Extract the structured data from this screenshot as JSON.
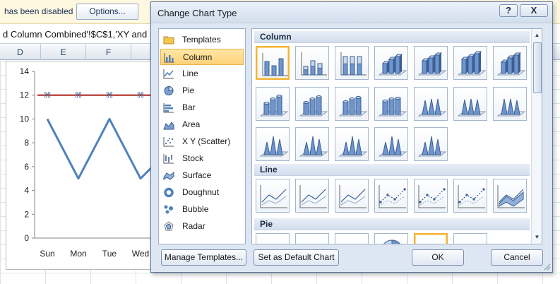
{
  "excel": {
    "message": "has been disabled",
    "options_label": "Options...",
    "formula": "d Column Combined'!$C$1,'XY and",
    "columns": [
      "D",
      "E",
      "F"
    ]
  },
  "chart_data": {
    "type": "line",
    "categories": [
      "Sun",
      "Mon",
      "Tue",
      "Wed"
    ],
    "series": [
      {
        "values": [
          10,
          5,
          10,
          5
        ],
        "color": "#4f81bd"
      },
      {
        "values": [
          12,
          12,
          12,
          12
        ],
        "color": "#c0504d"
      }
    ],
    "ylim": [
      0,
      14
    ],
    "yticks": [
      "14",
      "12",
      "10",
      "8",
      "6",
      "4",
      "2",
      "0"
    ],
    "grid": false
  },
  "dialog": {
    "title": "Change Chart Type",
    "help": "?",
    "close": "X",
    "chart_types": [
      {
        "label": "Templates",
        "icon": "folder-icon"
      },
      {
        "label": "Column",
        "icon": "column-chart-icon",
        "selected": true
      },
      {
        "label": "Line",
        "icon": "line-chart-icon"
      },
      {
        "label": "Pie",
        "icon": "pie-chart-icon"
      },
      {
        "label": "Bar",
        "icon": "bar-chart-icon"
      },
      {
        "label": "Area",
        "icon": "area-chart-icon"
      },
      {
        "label": "X Y (Scatter)",
        "icon": "scatter-chart-icon"
      },
      {
        "label": "Stock",
        "icon": "stock-chart-icon"
      },
      {
        "label": "Surface",
        "icon": "surface-chart-icon"
      },
      {
        "label": "Doughnut",
        "icon": "doughnut-chart-icon"
      },
      {
        "label": "Bubble",
        "icon": "bubble-chart-icon"
      },
      {
        "label": "Radar",
        "icon": "radar-chart-icon"
      }
    ],
    "sections": {
      "column": "Column",
      "line": "Line",
      "pie": "Pie"
    },
    "manage_templates": "Manage Templates...",
    "set_default": "Set as Default Chart",
    "ok": "OK",
    "cancel": "Cancel"
  }
}
